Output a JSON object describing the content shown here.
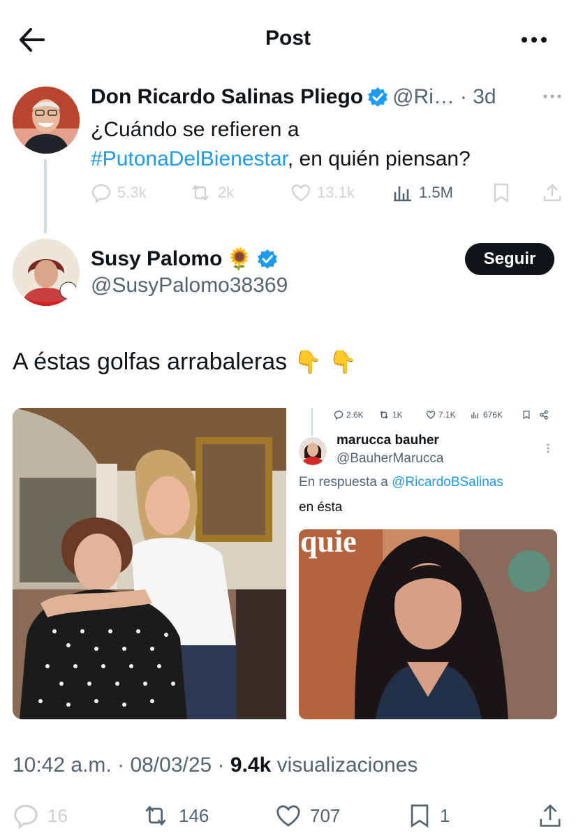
{
  "header": {
    "title": "Post",
    "back_icon": "arrow-left-icon",
    "more_icon": "more-horizontal-icon"
  },
  "parent_post": {
    "author_name": "Don Ricardo Salinas Pliego",
    "handle": "@Ri…",
    "time": "· 3d",
    "text_before": "¿Cuándo se refieren a",
    "hashtag": "#PutonaDelBienestar",
    "text_after": ", en quién piensan?",
    "stats": {
      "replies": "5.3k",
      "reposts": "2k",
      "likes": "13.1k",
      "views": "1.5M"
    }
  },
  "post": {
    "author_name": "Susy Palomo",
    "author_emoji": "🌻",
    "handle": "@SusyPalomo38369",
    "follow_label": "Seguir",
    "text": "A éstas  golfas arrabaleras",
    "emojis": [
      "👇",
      "👇"
    ]
  },
  "embedded_screenshot": {
    "stats": {
      "replies": "2.6K",
      "reposts": "1K",
      "likes": "7.1K",
      "views": "676K"
    },
    "author_name": "marucca bauher",
    "handle": "@BauherMarucca",
    "reply_prefix": "En respuesta a",
    "reply_to": "@RicardoBSalinas",
    "text": "en ésta",
    "magazine_fragment": "quie"
  },
  "meta": {
    "time": "10:42 a.m.",
    "date": "08/03/25",
    "views_count": "9.4k",
    "views_label": "visualizaciones"
  },
  "actions": {
    "replies": "16",
    "reposts": "146",
    "likes": "707",
    "bookmarks": "1"
  },
  "colors": {
    "accent": "#1d9bf0",
    "text": "#0f1419",
    "muted": "#536471",
    "divider": "#cfd9de"
  }
}
